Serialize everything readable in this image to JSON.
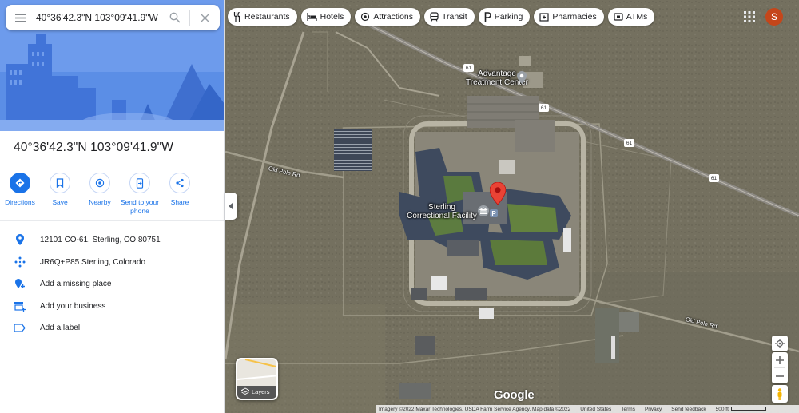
{
  "search": {
    "value": "40°36'42.3\"N 103°09'41.9\"W"
  },
  "place": {
    "title": "40°36'42.3\"N 103°09'41.9\"W"
  },
  "actions": [
    {
      "label": "Directions",
      "icon": "directions-icon"
    },
    {
      "label": "Save",
      "icon": "bookmark-icon"
    },
    {
      "label": "Nearby",
      "icon": "nearby-icon"
    },
    {
      "label": "Send to your phone",
      "icon": "phone-icon"
    },
    {
      "label": "Share",
      "icon": "share-icon"
    }
  ],
  "info": [
    {
      "text": "12101 CO-61, Sterling, CO 80751",
      "icon": "location-pin-icon"
    },
    {
      "text": "JR6Q+P85 Sterling, Colorado",
      "icon": "plus-code-icon"
    },
    {
      "text": "Add a missing place",
      "icon": "add-place-icon"
    },
    {
      "text": "Add your business",
      "icon": "storefront-icon"
    },
    {
      "text": "Add a label",
      "icon": "label-icon"
    }
  ],
  "chips": [
    {
      "label": "Restaurants",
      "icon": "restaurant-icon"
    },
    {
      "label": "Hotels",
      "icon": "hotel-icon"
    },
    {
      "label": "Attractions",
      "icon": "attractions-icon"
    },
    {
      "label": "Transit",
      "icon": "transit-icon"
    },
    {
      "label": "Parking",
      "icon": "parking-icon"
    },
    {
      "label": "Pharmacies",
      "icon": "pharmacy-icon"
    },
    {
      "label": "ATMs",
      "icon": "atm-icon"
    }
  ],
  "user": {
    "initial": "S",
    "color": "#c5461a"
  },
  "map": {
    "labels": {
      "advantage": "Advantage\nTreatment Center",
      "sterling": "Sterling\nCorrectional Facility"
    },
    "roads": {
      "old_pole_rd": "Old Pole Rd",
      "route": "61"
    },
    "layers_label": "Layers",
    "logo": "Google"
  },
  "footer": {
    "attribution": "Imagery ©2022 Maxar Technologies, USDA Farm Service Agency, Map data ©2022",
    "country": "United States",
    "terms": "Terms",
    "privacy": "Privacy",
    "feedback": "Send feedback",
    "scale": "500 ft"
  },
  "colors": {
    "accent": "#1a73e8",
    "pin": "#ea4335",
    "hero_bg": "#4f86e8"
  }
}
